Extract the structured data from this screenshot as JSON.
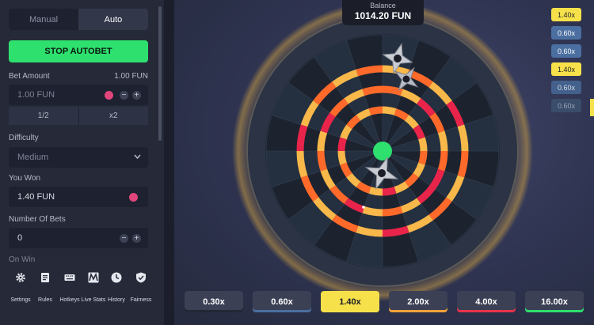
{
  "tabs": [
    {
      "label": "Manual"
    },
    {
      "label": "Auto"
    }
  ],
  "stop_label": "STOP AUTOBET",
  "bet_amount": {
    "label": "Bet Amount",
    "value_right": "1.00 FUN",
    "input": "1.00 FUN",
    "half": "1/2",
    "double": "x2"
  },
  "difficulty": {
    "label": "Difficulty",
    "value": "Medium"
  },
  "you_won": {
    "label": "You Won",
    "value": "1.40 FUN"
  },
  "num_bets": {
    "label": "Number Of Bets",
    "value": "0"
  },
  "on_win": {
    "label": "On Win"
  },
  "menu": [
    {
      "label": "Settings",
      "icon": "gear-icon"
    },
    {
      "label": "Rules",
      "icon": "rules-icon"
    },
    {
      "label": "Hotkeys",
      "icon": "keyboard-icon"
    },
    {
      "label": "Live Stats",
      "icon": "live-stats-icon"
    },
    {
      "label": "History",
      "icon": "clock-icon"
    },
    {
      "label": "Fairness",
      "icon": "shield-icon"
    }
  ],
  "balance": {
    "label": "Balance",
    "value": "1014.20 FUN"
  },
  "history": [
    {
      "value": "1.40x",
      "bg": "#f7e14a",
      "fg": "#1b1e29"
    },
    {
      "value": "0.60x",
      "bg": "#4b6fa0",
      "fg": "#ffffff"
    },
    {
      "value": "0.60x",
      "bg": "#4b6fa0",
      "fg": "#ffffff"
    },
    {
      "value": "1.40x",
      "bg": "#f7e14a",
      "fg": "#1b1e29"
    },
    {
      "value": "0.60x",
      "bg": "#43618c",
      "fg": "#d8dbe6"
    },
    {
      "value": "0.60x",
      "bg": "#3a4d6b",
      "fg": "#9aa3b8"
    }
  ],
  "multipliers": [
    {
      "value": "0.30x",
      "bg": "#3b4055",
      "fg": "#ffffff",
      "accent": "#232634"
    },
    {
      "value": "0.60x",
      "bg": "#3b4055",
      "fg": "#ffffff",
      "accent": "#4b6fa0"
    },
    {
      "value": "1.40x",
      "bg": "#f7e14a",
      "fg": "#1b1e29",
      "accent": "#f7e14a"
    },
    {
      "value": "2.00x",
      "bg": "#3b4055",
      "fg": "#ffffff",
      "accent": "#f2a23a"
    },
    {
      "value": "4.00x",
      "bg": "#3b4055",
      "fg": "#ffffff",
      "accent": "#e8344a"
    },
    {
      "value": "16.00x",
      "bg": "#3b4055",
      "fg": "#ffffff",
      "accent": "#2ee06e"
    }
  ],
  "colors": {
    "accent": "#2ee06e",
    "yellow": "#f7e14a",
    "orange": "#ff6a2b",
    "red": "#e8244a",
    "dark": "#1c232e"
  }
}
